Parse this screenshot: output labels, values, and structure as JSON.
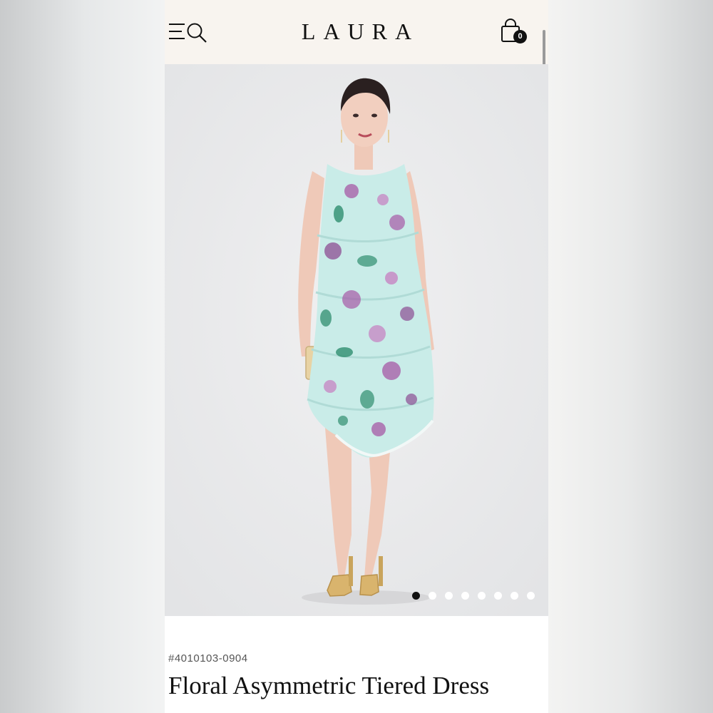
{
  "header": {
    "logo": "LAURA",
    "bag_count": "0",
    "icons": [
      "menu-icon",
      "search-icon",
      "shopping-bag-icon"
    ]
  },
  "gallery": {
    "image_count": 8,
    "active_index": 0
  },
  "product": {
    "sku": "#4010103-0904",
    "title": "Floral Asymmetric Tiered Dress"
  },
  "colors": {
    "header_bg": "#f8f4ef",
    "dress_base": "#c9ece8",
    "dress_floral_purple": "#a65aa6",
    "dress_floral_green": "#2f8e6f",
    "text_primary": "#111111",
    "text_secondary": "#555555"
  }
}
